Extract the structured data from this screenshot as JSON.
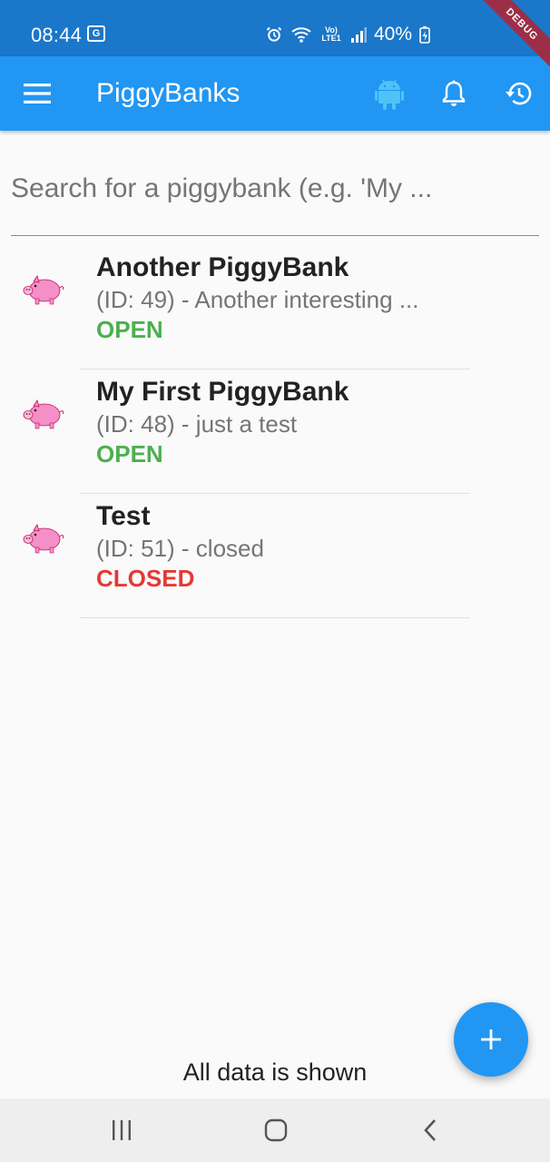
{
  "status_bar": {
    "time": "08:44",
    "translate_icon_glyph": "G",
    "volte_label": "Vo) LTE1",
    "battery": "40%"
  },
  "debug_banner": "DEBUG",
  "app_bar": {
    "title": "PiggyBanks",
    "icons": [
      "menu-icon",
      "android-icon",
      "bell-icon",
      "history-icon"
    ],
    "android_color": "#4fc3f7"
  },
  "search": {
    "placeholder": "Search for a piggybank (e.g. 'My ..."
  },
  "piggybanks": [
    {
      "title": "Another PiggyBank",
      "subtitle": "(ID: 49) - Another interesting ...",
      "status": "OPEN"
    },
    {
      "title": "My First PiggyBank",
      "subtitle": "(ID: 48) - just a test",
      "status": "OPEN"
    },
    {
      "title": "Test",
      "subtitle": "(ID: 51) - closed",
      "status": "CLOSED"
    }
  ],
  "footer": {
    "message": "All data is shown"
  },
  "fab": {
    "icon": "plus-icon"
  },
  "colors": {
    "primary": "#2196f3",
    "status_bar": "#1a77c9",
    "open": "#4caf50",
    "closed": "#e53935"
  },
  "nav_bar": {
    "icons": [
      "recent-apps-icon",
      "home-icon",
      "back-icon"
    ]
  }
}
